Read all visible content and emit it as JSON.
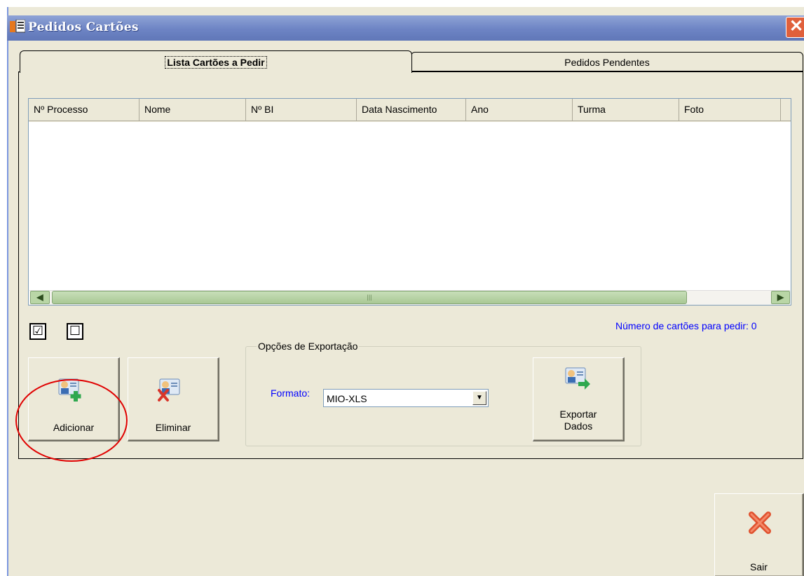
{
  "window": {
    "title": "Pedidos Cartões",
    "close_icon": "close-icon"
  },
  "tabs": [
    {
      "label": "Lista Cartões a Pedir",
      "active": true
    },
    {
      "label": "Pedidos Pendentes",
      "active": false
    }
  ],
  "grid": {
    "columns": [
      "Nº Processo",
      "Nome",
      "Nº BI",
      "Data Nascimento",
      "Ano",
      "Turma",
      "Foto"
    ],
    "rows": []
  },
  "selection": {
    "check_all_glyph": "☑",
    "uncheck_all_glyph": "☐"
  },
  "count_label": "Número de cartões para pedir: 0",
  "buttons": {
    "add_label": "Adicionar",
    "delete_label": "Eliminar",
    "export_label_line1": "Exportar",
    "export_label_line2": "Dados",
    "exit_label": "Sair"
  },
  "export_options": {
    "legend": "Opções de Exportação",
    "format_label": "Formato:",
    "format_value": "MIO-XLS"
  },
  "colors": {
    "accent_link": "#0000ff",
    "highlight": "#e00000",
    "titlebar": "#6d84c4"
  }
}
